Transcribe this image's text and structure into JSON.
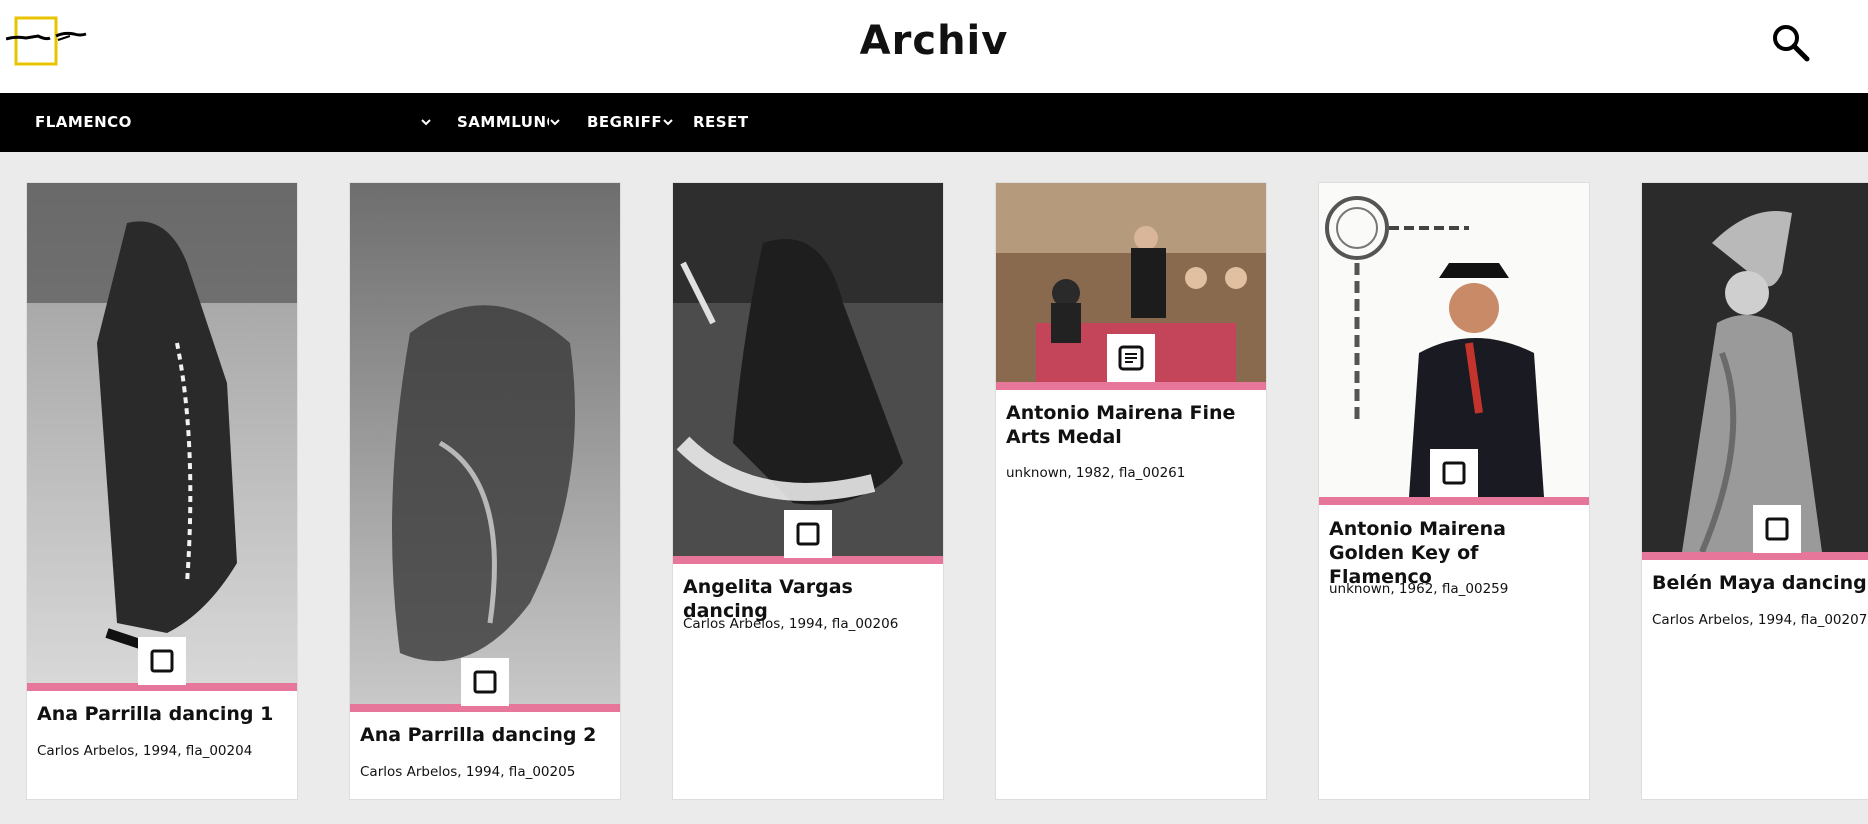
{
  "header": {
    "title": "Archiv",
    "logo_icon": "archive-logo-icon",
    "search_icon": "search-icon"
  },
  "nav": {
    "collection_select": "FLAMENCO",
    "sammlung": "SAMMLUNG",
    "begriff": "BEGRIFF",
    "reset": "RESET"
  },
  "colors": {
    "accent": "#e6779a",
    "logo_yellow": "#e8c400",
    "nav_bg": "#000000",
    "page_bg": "#ebebeb"
  },
  "cards": [
    {
      "title": "Ana Parrilla dancing 1",
      "meta": "Carlos Arbelos, 1994, fla_00204",
      "type_icon": "image-type-icon"
    },
    {
      "title": "Ana Parrilla dancing 2",
      "meta": "Carlos Arbelos, 1994, fla_00205",
      "type_icon": "image-type-icon"
    },
    {
      "title": "Angelita Vargas dancing",
      "meta": "Carlos Arbelos, 1994, fla_00206",
      "type_icon": "image-type-icon"
    },
    {
      "title": "Antonio Mairena Fine Arts Medal",
      "meta": "unknown, 1982, fla_00261",
      "type_icon": "document-type-icon"
    },
    {
      "title": "Antonio Mairena Golden Key of Flamenco",
      "meta": "unknown, 1962, fla_00259",
      "type_icon": "image-type-icon"
    },
    {
      "title": "Belén Maya dancing",
      "meta": "Carlos Arbelos, 1994, fla_00207",
      "type_icon": "image-type-icon"
    }
  ]
}
